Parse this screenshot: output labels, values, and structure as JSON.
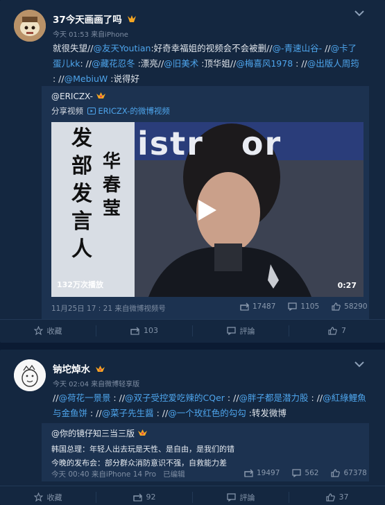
{
  "post1": {
    "username": "37今天画画了吗",
    "meta": "今天 01:53 来自iPhone",
    "text_line1": [
      {
        "t": "就很失望//",
        "link": false
      },
      {
        "t": "@友天Youtian",
        "link": true
      },
      {
        "t": ":好奇幸福姐的视频会不会被删//",
        "link": false
      },
      {
        "t": "@-青速山谷-",
        "link": true
      },
      {
        "t": " //",
        "link": false
      },
      {
        "t": "@卡了",
        "link": true
      }
    ],
    "text_line2": [
      {
        "t": "蛋儿kk",
        "link": true
      },
      {
        "t": ": //",
        "link": false
      },
      {
        "t": "@藏花忍冬",
        "link": true
      },
      {
        "t": " :漂亮//",
        "link": false
      },
      {
        "t": "@旧美术",
        "link": true
      },
      {
        "t": " :顶华姐//",
        "link": false
      },
      {
        "t": "@梅喜风1978",
        "link": true
      },
      {
        "t": " : //",
        "link": false
      },
      {
        "t": "@出版人周筠",
        "link": true
      }
    ],
    "text_line3": [
      {
        "t": ": //",
        "link": false
      },
      {
        "t": "@MebiuW",
        "link": true
      },
      {
        "t": " :说得好",
        "link": false
      }
    ],
    "repost": {
      "author": "@ERICZX-",
      "share_prefix": "分享视频",
      "share_link": "ERICZX-的微博视频",
      "video_caption_lines": [
        "发",
        "部",
        "发",
        "言",
        "人"
      ],
      "video_name_lines": [
        "华",
        "春",
        "莹"
      ],
      "video_bg_text": "istr   or",
      "plays": "132万次播放",
      "duration": "0:27",
      "time": "11月25日 17 : 21 来自微博视频号",
      "stats": {
        "reposts": "17487",
        "comments": "1105",
        "likes": "58290"
      }
    },
    "footer": {
      "favorite": "收藏",
      "repost": "103",
      "comment": "評論",
      "like": "7"
    }
  },
  "post2": {
    "username": "钠坨焯水",
    "meta": "今天 02:04 来自微博轻享版",
    "text_line1": [
      {
        "t": "//",
        "link": false
      },
      {
        "t": "@荷花一景景",
        "link": true
      },
      {
        "t": " : //",
        "link": false
      },
      {
        "t": "@双子受控爱吃辣的CQer",
        "link": true
      },
      {
        "t": " : //",
        "link": false
      },
      {
        "t": "@胖子都是潜力股",
        "link": true
      },
      {
        "t": " : //",
        "link": false
      },
      {
        "t": "@紅綠鯉魚",
        "link": true
      }
    ],
    "text_line2": [
      {
        "t": "与金鱼饼",
        "link": true
      },
      {
        "t": " : //",
        "link": false
      },
      {
        "t": "@菜子先生醤",
        "link": true
      },
      {
        "t": " : //",
        "link": false
      },
      {
        "t": "@一个玫红色的勾勾",
        "link": true
      },
      {
        "t": " :转发微博",
        "link": false
      }
    ],
    "repost": {
      "author": "@你的镜仔知三当三版",
      "line1": "韩国总理：年轻人出去玩是天性、是自由，是我们的错",
      "line2": "今晚的发布会：部分群众消防意识不强，自救能力差",
      "time": "今天 00:40 来自iPhone 14 Pro   已编辑",
      "stats": {
        "reposts": "19497",
        "comments": "562",
        "likes": "67378"
      }
    },
    "footer": {
      "favorite": "收藏",
      "repost": "92",
      "comment": "評論",
      "like": "37"
    }
  },
  "colors": {
    "page_bg": "#0b1b33",
    "card_bg": "#142740",
    "repost_bg": "#1c3250",
    "link": "#4ea5ec",
    "vip_badge": "#f5a623"
  },
  "icons": [
    "chevron-down-icon",
    "play-icon",
    "repost-icon",
    "comment-icon",
    "like-icon",
    "favorite-icon",
    "crown-badge-icon",
    "vip-badge-icon"
  ]
}
